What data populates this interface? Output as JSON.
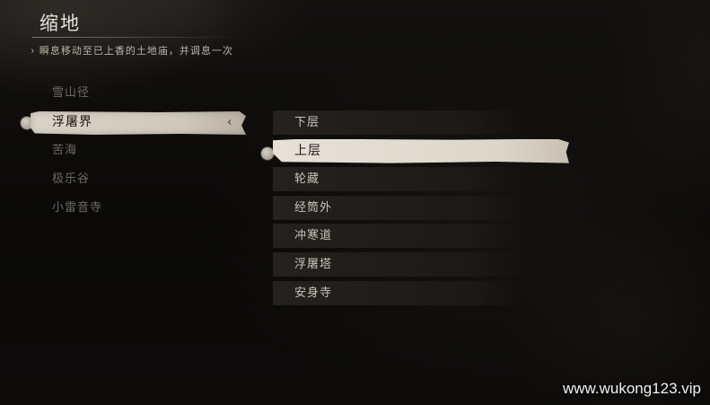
{
  "header": {
    "title": "缩地",
    "subtitle": "› 瞬息移动至已上香的土地庙，并调息一次"
  },
  "regions": {
    "selected_index": 1,
    "items": [
      {
        "label": "雪山径"
      },
      {
        "label": "浮屠界"
      },
      {
        "label": "苦海"
      },
      {
        "label": "极乐谷"
      },
      {
        "label": "小雷音寺"
      }
    ],
    "expand_glyph": "‹"
  },
  "shrines": {
    "selected_index": 1,
    "items": [
      {
        "label": "下层"
      },
      {
        "label": "上层"
      },
      {
        "label": "轮藏"
      },
      {
        "label": "经筒外"
      },
      {
        "label": "冲寒道"
      },
      {
        "label": "浮屠塔"
      },
      {
        "label": "安身寺"
      }
    ]
  },
  "watermark": "www.wukong123.vip",
  "colors": {
    "background": "#0b0a09",
    "highlight": "#ddd7cb",
    "text_light": "#c9c3b8",
    "text_dim": "#6e6a64"
  }
}
